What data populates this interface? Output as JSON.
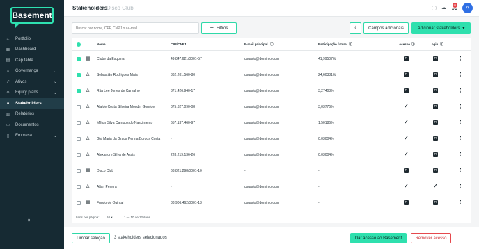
{
  "brand": {
    "name": "Basement"
  },
  "sidebar": {
    "items": [
      {
        "label": "Portfolio",
        "icon": "arrow-left-icon",
        "chevron": false,
        "active": false
      },
      {
        "label": "Dashboard",
        "icon": "dashboard-icon",
        "chevron": false,
        "active": false
      },
      {
        "label": "Cap table",
        "icon": "table-icon",
        "chevron": false,
        "active": false
      },
      {
        "label": "Governança",
        "icon": "bank-icon",
        "chevron": true,
        "active": false
      },
      {
        "label": "Ativos",
        "icon": "trend-icon",
        "chevron": true,
        "active": false
      },
      {
        "label": "Equity plans",
        "icon": "code-icon",
        "chevron": true,
        "active": false
      },
      {
        "label": "Stakeholders",
        "icon": "users-icon",
        "chevron": false,
        "active": true
      },
      {
        "label": "Relatórios",
        "icon": "report-icon",
        "chevron": false,
        "active": false
      },
      {
        "label": "Documentos",
        "icon": "folder-icon",
        "chevron": false,
        "active": false
      },
      {
        "label": "Empresa",
        "icon": "building-icon",
        "chevron": true,
        "active": false
      }
    ]
  },
  "header": {
    "title": "Stakeholders",
    "subtitle": "Disco Club",
    "notification_count": "11",
    "avatar_letter": "A"
  },
  "toolbar": {
    "search_placeholder": "Buscar por nome, CPF, CNPJ ou e-mail",
    "filters_label": "Filtros",
    "extra_fields_label": "Campos adicionais",
    "add_label": "Adicionar stakeholders"
  },
  "table": {
    "headers": {
      "name": "Nome",
      "doc": "CPF/CNPJ",
      "email": "E-mail principal",
      "participation": "Participação futura",
      "access": "Acesso",
      "login": "Login"
    },
    "rows": [
      {
        "checked": true,
        "type": "company",
        "name": "Clube da Esquina",
        "doc": "49.847.621/0001-57",
        "email": "usuario@dominio.com",
        "participation": "41,99507%",
        "access": "x",
        "login": "x"
      },
      {
        "checked": true,
        "type": "person",
        "name": "Sebastião Rodrigues Maia",
        "doc": "362.201.560-80",
        "email": "usuario@dominio.com",
        "participation": "24,60381%",
        "access": "x",
        "login": "x"
      },
      {
        "checked": true,
        "type": "person",
        "name": "Rita Lee Jones de Carvalho",
        "doc": "371.426.940-17",
        "email": "usuario@dominio.com",
        "participation": "3,27408%",
        "access": "x",
        "login": "x"
      },
      {
        "checked": false,
        "type": "person",
        "name": "Alaíde Costa Silveira Mondin Gomide",
        "doc": "875.327.090-08",
        "email": "usuario@dominio.com",
        "participation": "3,03776%",
        "access": "check",
        "login": "x"
      },
      {
        "checked": false,
        "type": "person",
        "name": "Milton Silva Campos do Nascimento",
        "doc": "657.137.460-97",
        "email": "usuario@dominio.com",
        "participation": "1,50186%",
        "access": "check",
        "login": "x"
      },
      {
        "checked": false,
        "type": "person",
        "name": "Gal Maria da Graça Penna Burgos Costa",
        "doc": "-",
        "email": "usuario@dominio.com",
        "participation": "0,03004%",
        "access": "check",
        "login": "x"
      },
      {
        "checked": false,
        "type": "person",
        "name": "Alexandre Silva de Assis",
        "doc": "228.219.136-26",
        "email": "usuario@dominio.com",
        "participation": "0,03004%",
        "access": "check",
        "login": "x"
      },
      {
        "checked": false,
        "type": "company",
        "name": "Disco Club",
        "doc": "63.821.298/0001-10",
        "email": "-",
        "participation": "-",
        "access": "x",
        "login": "x"
      },
      {
        "checked": false,
        "type": "person",
        "name": "Allan Pereira",
        "doc": "-",
        "email": "usuario@dominio.com",
        "participation": "-",
        "access": "check",
        "login": "check"
      },
      {
        "checked": false,
        "type": "company",
        "name": "Fundo de Quintal",
        "doc": "88.906.462/0001-13",
        "email": "usuario@dominio.com",
        "participation": "-",
        "access": "x",
        "login": "x"
      }
    ]
  },
  "pager": {
    "items_per_page_label": "Itens por página:",
    "page_size": "10",
    "range_label": "1 — 10 de 12 itens"
  },
  "bottom": {
    "clear_label": "Limpar seleção",
    "selected_label": "3 stakeholders selecionados",
    "grant_label": "Dar acesso ao Basement",
    "remove_label": "Remover acesso"
  },
  "colors": {
    "accent": "#2fe0ae",
    "sidebar": "#162a33",
    "danger": "#e5484d"
  }
}
